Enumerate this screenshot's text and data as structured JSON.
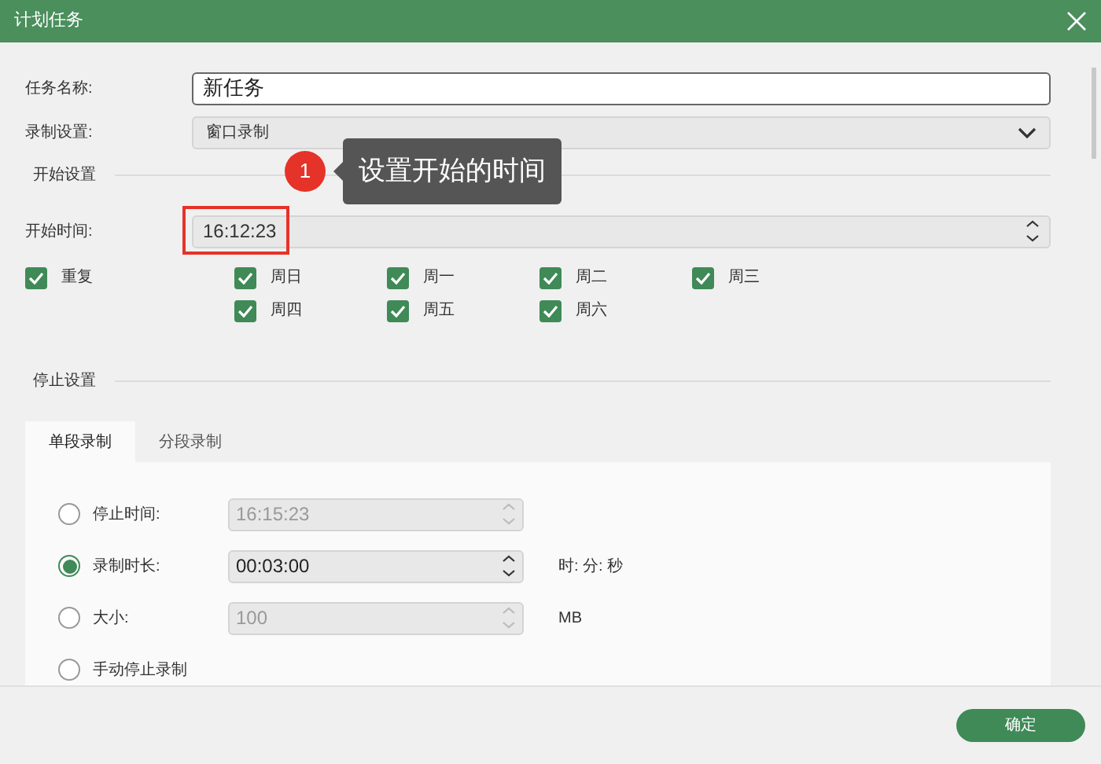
{
  "window": {
    "title": "计划任务"
  },
  "task_name": {
    "label": "任务名称:",
    "value": "新任务"
  },
  "record_setting": {
    "label": "录制设置:",
    "value": "窗口录制"
  },
  "start_section": {
    "title": "开始设置"
  },
  "callout": {
    "number": "1",
    "text": "设置开始的时间"
  },
  "start_time": {
    "label": "开始时间:",
    "value": "16:12:23",
    "highlighted": true
  },
  "repeat": {
    "label": "重复",
    "checked": true
  },
  "days": [
    {
      "label": "周日",
      "checked": true
    },
    {
      "label": "周一",
      "checked": true
    },
    {
      "label": "周二",
      "checked": true
    },
    {
      "label": "周三",
      "checked": true
    },
    {
      "label": "周四",
      "checked": true
    },
    {
      "label": "周五",
      "checked": true
    },
    {
      "label": "周六",
      "checked": true
    }
  ],
  "stop_section": {
    "title": "停止设置"
  },
  "tabs": [
    {
      "label": "单段录制",
      "selected": true
    },
    {
      "label": "分段录制",
      "selected": false
    }
  ],
  "stop_options": [
    {
      "label": "停止时间:",
      "selected": false,
      "value": "16:15:23",
      "disabled": true
    },
    {
      "label": "录制时长:",
      "selected": true,
      "value": "00:03:00",
      "disabled": false,
      "unit": "时: 分: 秒"
    },
    {
      "label": "大小:",
      "selected": false,
      "value": "100",
      "disabled": true,
      "unit": "MB"
    },
    {
      "label": "手动停止录制",
      "selected": false
    }
  ],
  "buttons": [
    {
      "label": "确定"
    }
  ]
}
